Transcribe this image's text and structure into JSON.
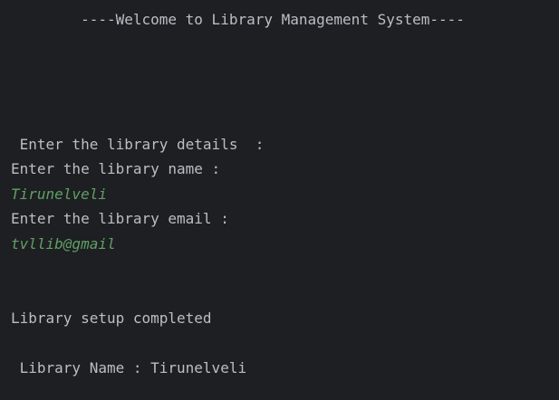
{
  "console": {
    "welcome_banner": "        ----Welcome to Library Management System----",
    "prompt_details": " Enter the library details  :",
    "prompt_name": "Enter the library name :",
    "input_name": "Tirunelveli",
    "prompt_email": "Enter the library email :",
    "input_email": "tvllib@gmail",
    "status_setup": "Library setup completed",
    "library_name_line": " Library Name : Tirunelveli"
  },
  "colors": {
    "background": "#1e1f22",
    "text": "#bcbec4",
    "user_input": "#5fa164"
  }
}
